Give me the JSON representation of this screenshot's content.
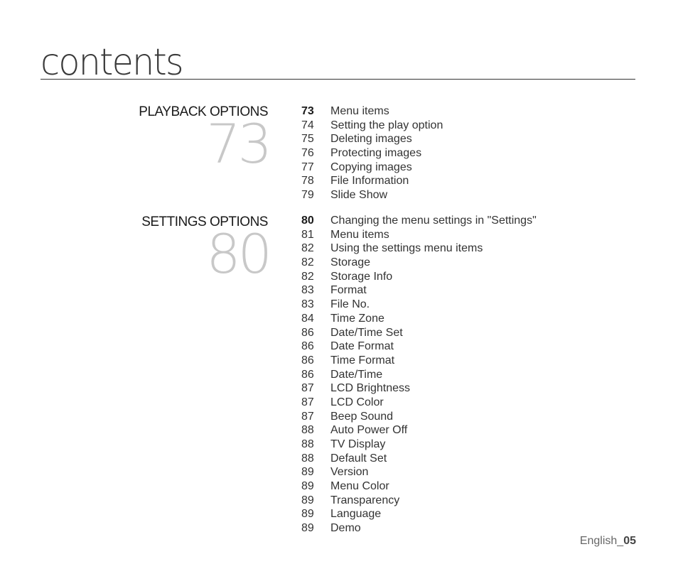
{
  "page": {
    "title": "contents",
    "footer": {
      "language": "English_",
      "page_number": "05"
    }
  },
  "sections": [
    {
      "title": "PLAYBACK OPTIONS",
      "start_page": "73",
      "entries": [
        {
          "page": "73",
          "label": "Menu items",
          "bold": true
        },
        {
          "page": "74",
          "label": "Setting the play option"
        },
        {
          "page": "75",
          "label": "Deleting images"
        },
        {
          "page": "76",
          "label": "Protecting images"
        },
        {
          "page": "77",
          "label": "Copying images"
        },
        {
          "page": "78",
          "label": "File Information"
        },
        {
          "page": "79",
          "label": "Slide Show"
        }
      ]
    },
    {
      "title": "SETTINGS OPTIONS",
      "start_page": "80",
      "entries": [
        {
          "page": "80",
          "label": "Changing the menu settings in \"Settings\"",
          "bold": true
        },
        {
          "page": "81",
          "label": "Menu items"
        },
        {
          "page": "82",
          "label": "Using the settings menu items"
        },
        {
          "page": "82",
          "label": "Storage"
        },
        {
          "page": "82",
          "label": "Storage Info"
        },
        {
          "page": "83",
          "label": "Format"
        },
        {
          "page": "83",
          "label": "File No."
        },
        {
          "page": "84",
          "label": "Time Zone"
        },
        {
          "page": "86",
          "label": "Date/Time Set"
        },
        {
          "page": "86",
          "label": "Date Format"
        },
        {
          "page": "86",
          "label": "Time Format"
        },
        {
          "page": "86",
          "label": "Date/Time"
        },
        {
          "page": "87",
          "label": "LCD Brightness"
        },
        {
          "page": "87",
          "label": "LCD Color"
        },
        {
          "page": "87",
          "label": "Beep Sound"
        },
        {
          "page": "88",
          "label": "Auto Power Off"
        },
        {
          "page": "88",
          "label": "TV Display"
        },
        {
          "page": "88",
          "label": "Default Set"
        },
        {
          "page": "89",
          "label": "Version"
        },
        {
          "page": "89",
          "label": "Menu Color"
        },
        {
          "page": "89",
          "label": "Transparency"
        },
        {
          "page": "89",
          "label": "Language"
        },
        {
          "page": "89",
          "label": "Demo"
        }
      ]
    }
  ]
}
